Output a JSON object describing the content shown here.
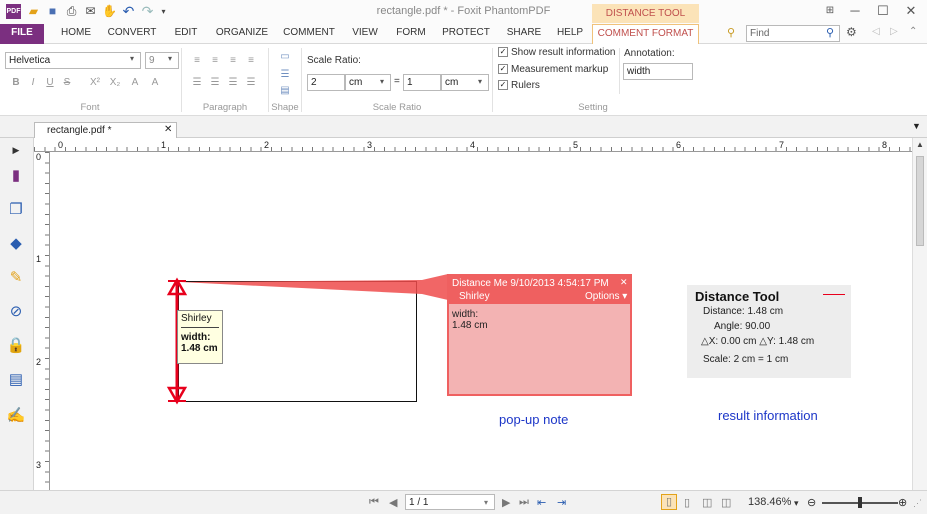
{
  "app": {
    "title": "rectangle.pdf * - Foxit PhantomPDF"
  },
  "quick_access": [
    "app-logo-icon",
    "open-icon",
    "save-icon",
    "print-icon",
    "email-icon",
    "hand-icon",
    "undo-icon",
    "redo-icon",
    "dropdown-icon"
  ],
  "window_controls": [
    "restore-icon",
    "minimize-icon",
    "maximize-icon",
    "close-icon"
  ],
  "menu": {
    "context_header": "DISTANCE TOOL",
    "tabs": [
      "FILE",
      "HOME",
      "CONVERT",
      "EDIT",
      "ORGANIZE",
      "COMMENT",
      "VIEW",
      "FORM",
      "PROTECT",
      "SHARE",
      "HELP",
      "COMMENT FORMAT"
    ],
    "search_placeholder": "Find"
  },
  "ribbon": {
    "font": {
      "family": "Helvetica",
      "size": "9",
      "buttons": [
        "B",
        "I",
        "U",
        "S",
        "X²",
        "X₂",
        "A",
        "A"
      ],
      "label": "Font"
    },
    "paragraph": {
      "label": "Paragraph"
    },
    "shape": {
      "label": "Shape"
    },
    "scale_ratio": {
      "title": "Scale Ratio:",
      "left_value": "2",
      "left_unit": "cm",
      "equals": "=",
      "right_value": "1",
      "right_unit": "cm",
      "label": "Scale Ratio"
    },
    "setting": {
      "options": [
        {
          "label": "Show result information",
          "checked": true
        },
        {
          "label": "Measurement markup",
          "checked": true
        },
        {
          "label": "Rulers",
          "checked": true
        }
      ],
      "label": "Setting"
    },
    "annotation": {
      "title": "Annotation:",
      "value": "width"
    }
  },
  "document": {
    "tab_title": "rectangle.pdf *",
    "ruler_h": [
      "0",
      "1",
      "2",
      "3",
      "4",
      "5",
      "6",
      "7",
      "8"
    ],
    "ruler_v": [
      "0",
      "1",
      "2",
      "3"
    ]
  },
  "measurement": {
    "bubble_author": "Shirley",
    "bubble_text_1": "width:",
    "bubble_text_2": "1.48 cm"
  },
  "popup_note": {
    "title": "Distance Me 9/10/2013 4:54:17 PM",
    "author": "Shirley",
    "options_label": "Options",
    "body_1": "width:",
    "body_2": "1.48 cm",
    "caption": "pop-up note"
  },
  "result": {
    "title": "Distance Tool",
    "distance": "Distance:   1.48 cm",
    "angle": "Angle:  90.00",
    "delta": "△X: 0.00 cm  △Y: 1.48 cm",
    "scale": "Scale:  2 cm = 1 cm",
    "caption": "result information"
  },
  "statusbar": {
    "page_value": "1 / 1",
    "zoom": "138.46%"
  },
  "colors": {
    "file_tab": "#7b2f80",
    "context_accent": "#c0504d",
    "measure_red": "#e8001c",
    "popup_red": "#ef6060",
    "caption_blue": "#1c36c8"
  }
}
